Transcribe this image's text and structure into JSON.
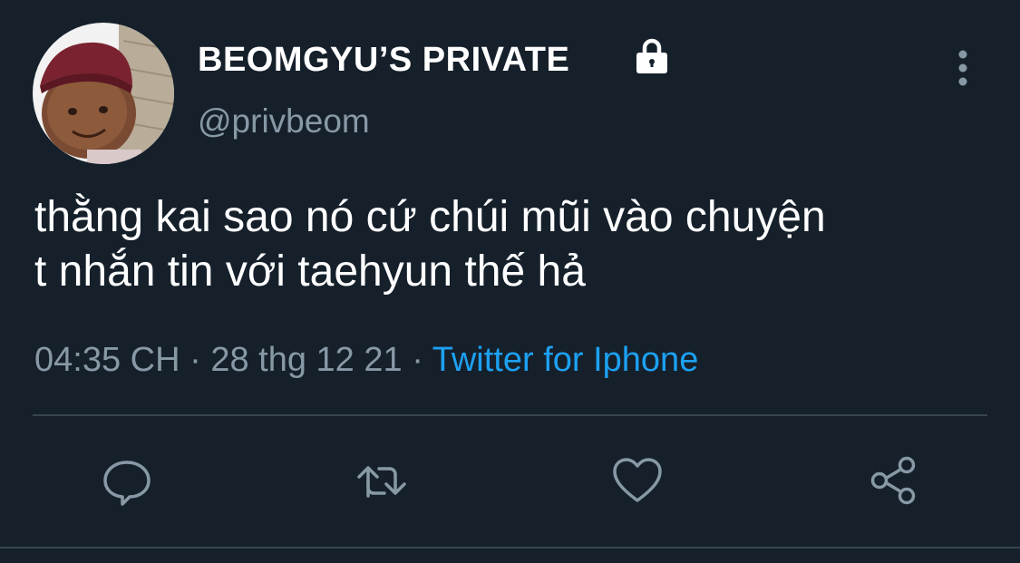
{
  "author": {
    "display_name": "BEOMGYU’S PRIVATE",
    "handle": "@privbeom",
    "protected": true,
    "avatar_icon": "profile-photo"
  },
  "tweet": {
    "text": "thằng kai sao nó cứ chúi mũi vào chuyện\nt nhắn tin với taehyun thế hả",
    "time": "04:35 CH",
    "date": "28 thg 12 21",
    "separator": "·",
    "source": "Twitter for Iphone"
  },
  "actions": [
    {
      "icon": "reply-icon"
    },
    {
      "icon": "retweet-icon"
    },
    {
      "icon": "like-icon"
    },
    {
      "icon": "share-icon"
    }
  ],
  "colors": {
    "background": "#15202b",
    "text": "#ffffff",
    "secondary": "#8899a6",
    "accent": "#1da1f2",
    "divider": "#38444d"
  }
}
